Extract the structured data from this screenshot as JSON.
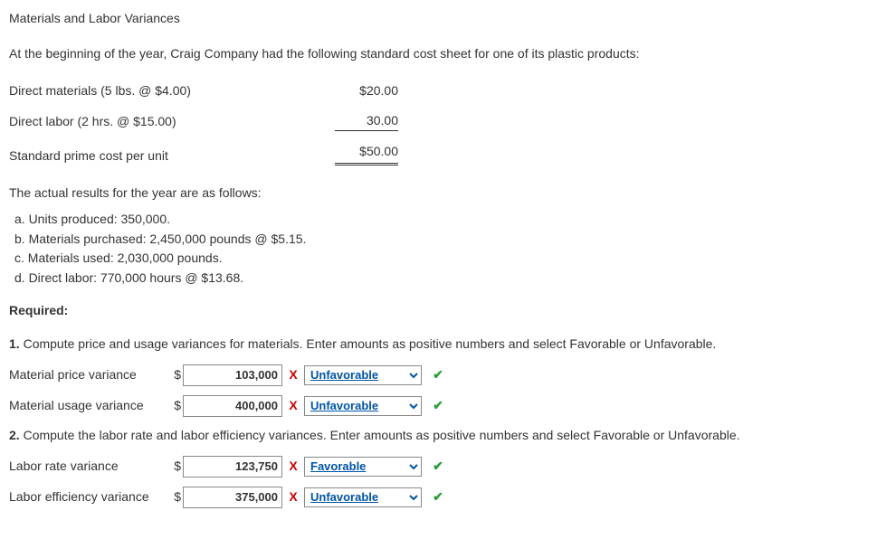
{
  "title": "Materials and Labor Variances",
  "intro": "At the beginning of the year, Craig Company had the following standard cost sheet for one of its plastic products:",
  "cost_sheet": {
    "dm_label": "Direct materials (5 lbs. @ $4.00)",
    "dm_value": "$20.00",
    "dl_label": "Direct labor (2 hrs. @ $15.00)",
    "dl_value": "30.00",
    "total_label": "Standard prime cost per unit",
    "total_value": "$50.00"
  },
  "results_intro": "The actual results for the year are as follows:",
  "results": {
    "a": "a. Units produced: 350,000.",
    "b": "b. Materials purchased: 2,450,000 pounds @ $5.15.",
    "c": "c. Materials used: 2,030,000 pounds.",
    "d": "d. Direct labor: 770,000 hours @ $13.68."
  },
  "required_label": "Required:",
  "q1": {
    "num": "1.",
    "text": " Compute price and usage variances for materials. Enter amounts as positive numbers and select Favorable or Unfavorable.",
    "rows": [
      {
        "label": "Material price variance",
        "value": "103,000",
        "amount_mark": "X",
        "select": "Unfavorable",
        "select_mark": "✔"
      },
      {
        "label": "Material usage variance",
        "value": "400,000",
        "amount_mark": "X",
        "select": "Unfavorable",
        "select_mark": "✔"
      }
    ]
  },
  "q2": {
    "num": "2.",
    "text": " Compute the labor rate and labor efficiency variances. Enter amounts as positive numbers and select Favorable or Unfavorable.",
    "rows": [
      {
        "label": "Labor rate variance",
        "value": "123,750",
        "amount_mark": "X",
        "select": "Favorable",
        "select_mark": "✔"
      },
      {
        "label": "Labor efficiency variance",
        "value": "375,000",
        "amount_mark": "X",
        "select": "Unfavorable",
        "select_mark": "✔"
      }
    ]
  },
  "options": [
    "Favorable",
    "Unfavorable"
  ],
  "glyphs": {
    "dollar": "$"
  }
}
